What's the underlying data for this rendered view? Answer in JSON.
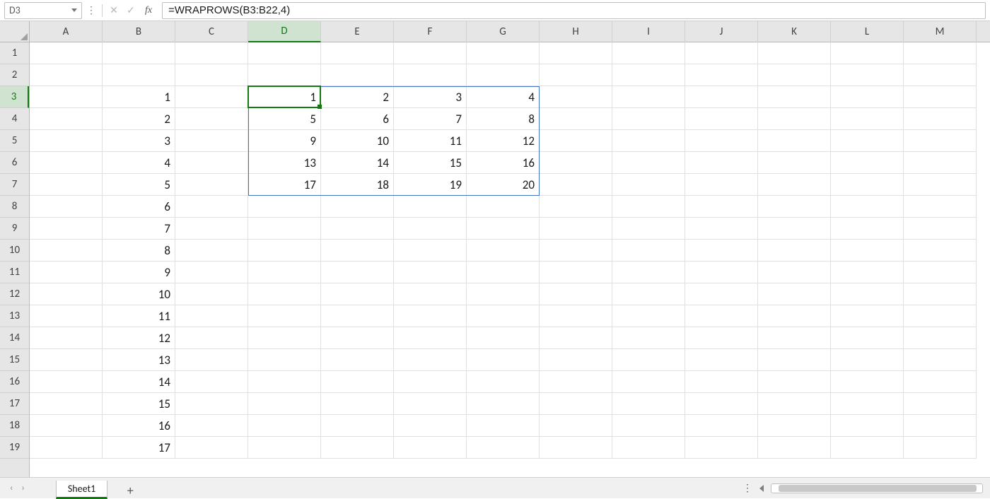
{
  "name_box": {
    "value": "D3"
  },
  "formula_bar": {
    "fx": "fx",
    "formula": "=WRAPROWS(B3:B22,4)"
  },
  "columns": [
    "A",
    "B",
    "C",
    "D",
    "E",
    "F",
    "G",
    "H",
    "I",
    "J",
    "K",
    "L",
    "M"
  ],
  "rows": [
    "1",
    "2",
    "3",
    "4",
    "5",
    "6",
    "7",
    "8",
    "9",
    "10",
    "11",
    "12",
    "13",
    "14",
    "15",
    "16",
    "17",
    "18",
    "19"
  ],
  "active_col": "D",
  "active_row": "3",
  "grid": {
    "B3": "1",
    "B4": "2",
    "B5": "3",
    "B6": "4",
    "B7": "5",
    "B8": "6",
    "B9": "7",
    "B10": "8",
    "B11": "9",
    "B12": "10",
    "B13": "11",
    "B14": "12",
    "B15": "13",
    "B16": "14",
    "B17": "15",
    "B18": "16",
    "B19": "17",
    "D3": "1",
    "E3": "2",
    "F3": "3",
    "G3": "4",
    "D4": "5",
    "E4": "6",
    "F4": "7",
    "G4": "8",
    "D5": "9",
    "E5": "10",
    "F5": "11",
    "G5": "12",
    "D6": "13",
    "E6": "14",
    "F6": "15",
    "G6": "16",
    "D7": "17",
    "E7": "18",
    "F7": "19",
    "G7": "20"
  },
  "sheet_tab": {
    "label": "Sheet1"
  },
  "add_sheet_icon": "+",
  "icons": {
    "cancel": "✕",
    "enter": "✓",
    "dots": "⋮",
    "menu": "⋮",
    "tri_left": "◀"
  }
}
